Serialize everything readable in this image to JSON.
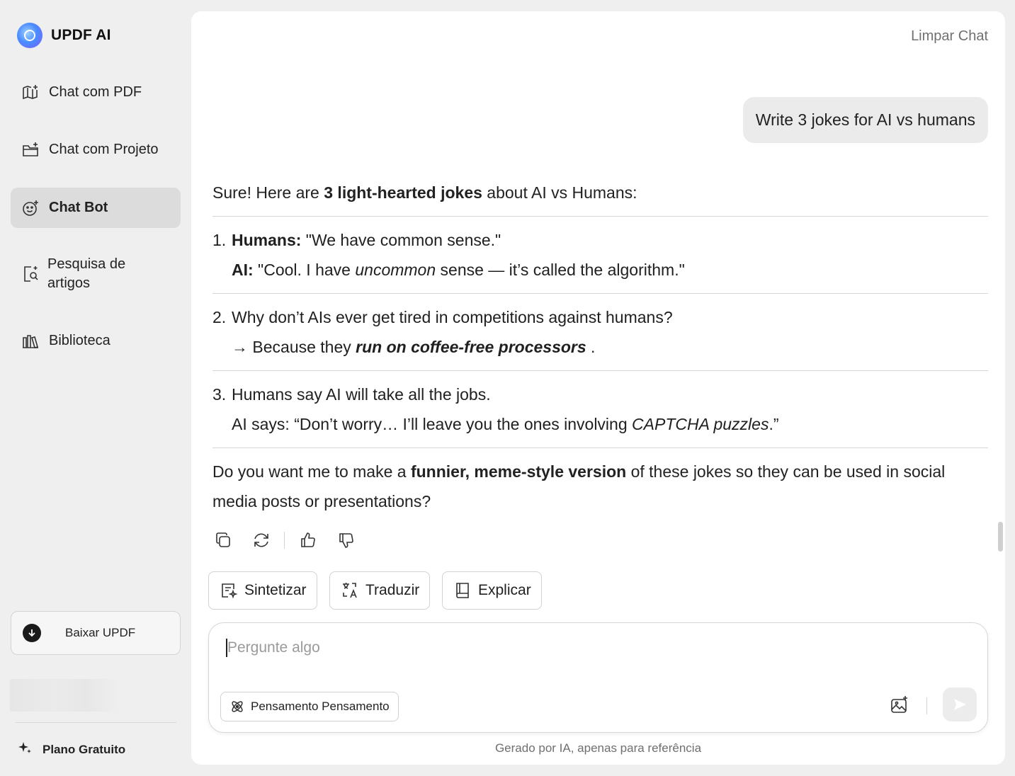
{
  "app": {
    "name": "UPDF AI"
  },
  "sidebar": {
    "items": [
      {
        "label": "Chat com PDF",
        "icon": "book-sparkle-icon"
      },
      {
        "label": "Chat com Projeto",
        "icon": "folder-sparkle-icon"
      },
      {
        "label": "Chat Bot",
        "icon": "bot-face-icon",
        "active": true
      },
      {
        "label": "Pesquisa de artigos",
        "icon": "doc-search-icon"
      },
      {
        "label": "Biblioteca",
        "icon": "library-icon"
      }
    ],
    "download_label": "Baixar UPDF",
    "plan_label": "Plano Gratuito"
  },
  "header": {
    "clear_label": "Limpar Chat"
  },
  "conversation": {
    "user_message": "Write 3 jokes for AI vs humans",
    "intro": {
      "pre": "Sure! Here are ",
      "bold": "3 light-hearted jokes",
      "post": " about AI vs Humans:"
    },
    "jokes": [
      {
        "num": "1.",
        "line1": {
          "bold": "Humans:",
          "text": " \"We have common sense.\""
        },
        "line2": {
          "bold": "AI:",
          "pre": " \"Cool. I have ",
          "italic": "uncommon",
          "post": " sense — it’s called the algorithm.\""
        }
      },
      {
        "num": "2.",
        "line1": {
          "text": "Why don’t AIs ever get tired in competitions against humans?"
        },
        "line2": {
          "pre": "→ Because they ",
          "bolditalic": "run on coffee-free processors",
          "post": " ."
        }
      },
      {
        "num": "3.",
        "line1": {
          "text": "Humans say AI will take all the jobs."
        },
        "line2": {
          "pre": "AI says: “Don’t worry… I’ll leave you the ones involving ",
          "italic": "CAPTCHA puzzles",
          "post": ".”"
        }
      }
    ],
    "outro": {
      "pre": "Do you want me to make a ",
      "bold": "funnier, meme-style version",
      "post": " of these jokes so they can be used in social media posts or presentations?"
    }
  },
  "actions": [
    "copy-icon",
    "regenerate-icon",
    "thumbs-up-icon",
    "thumbs-down-icon"
  ],
  "chips": [
    {
      "label": "Sintetizar",
      "icon": "summarize-icon"
    },
    {
      "label": "Traduzir",
      "icon": "translate-icon"
    },
    {
      "label": "Explicar",
      "icon": "book-icon"
    }
  ],
  "composer": {
    "placeholder": "Pergunte algo",
    "thinking_label": "Pensamento Pensamento"
  },
  "footnote": "Gerado por IA, apenas para referência"
}
